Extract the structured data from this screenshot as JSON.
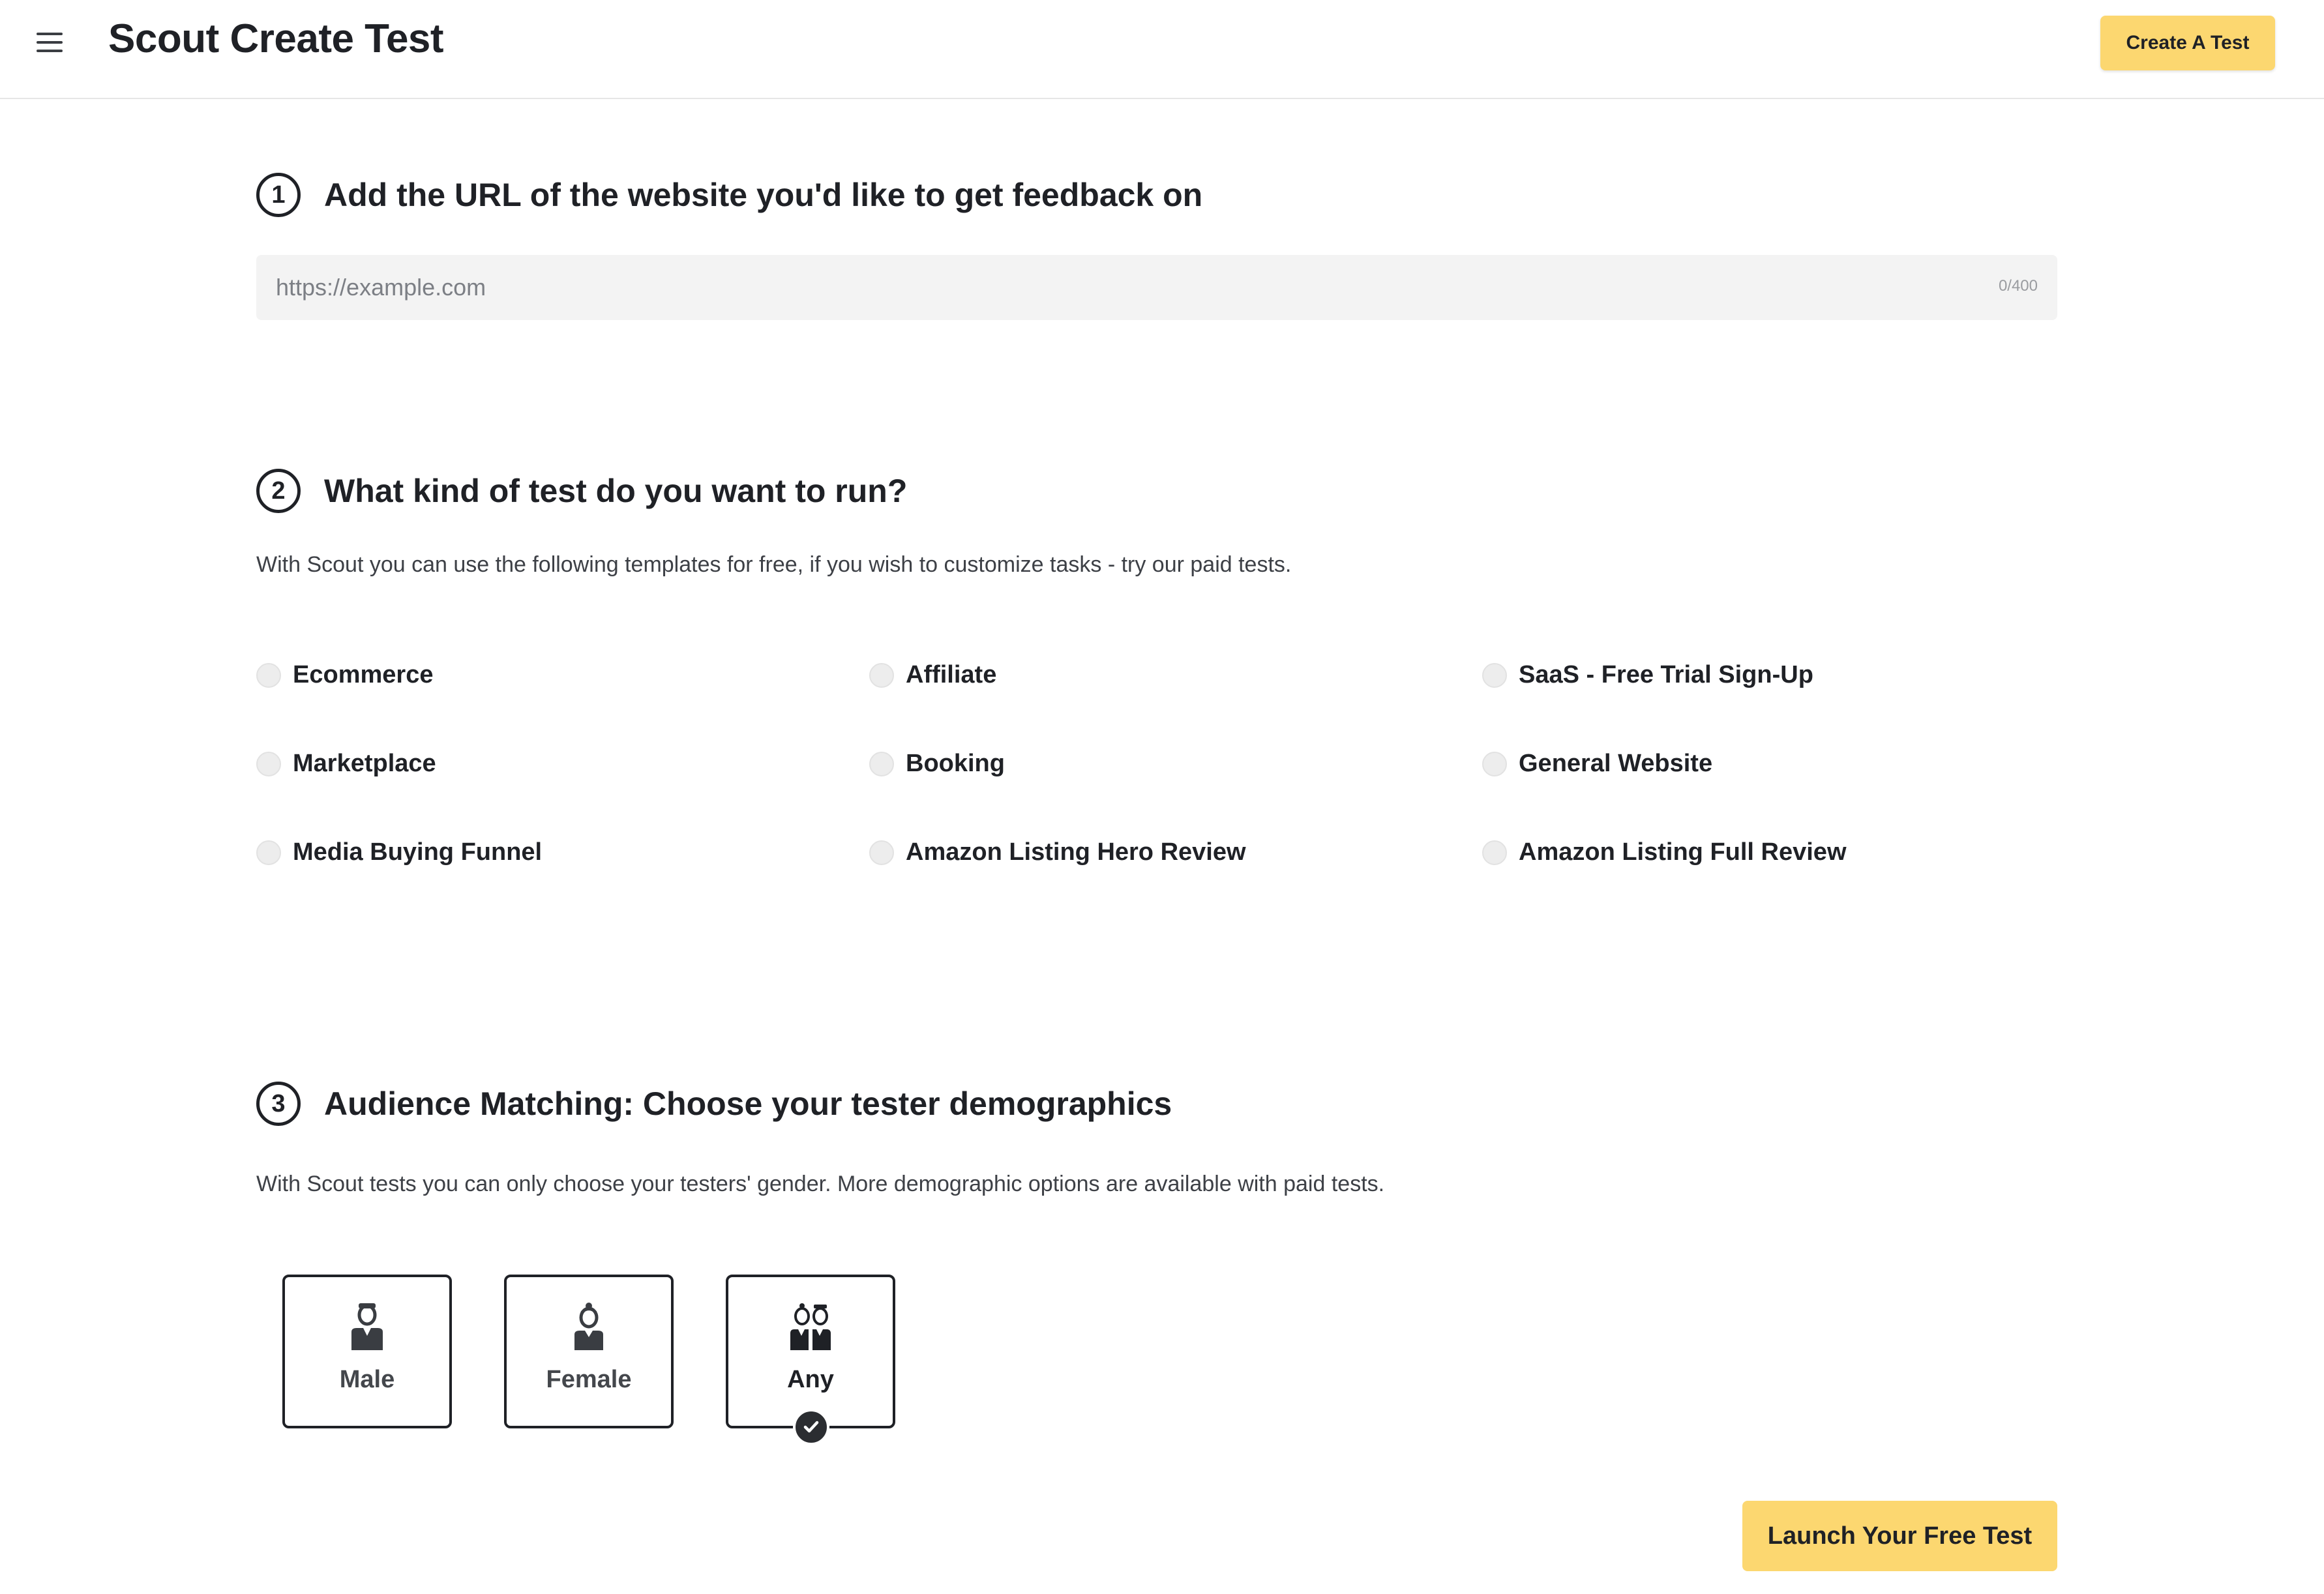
{
  "header": {
    "title": "Scout Create Test",
    "create_button": "Create A Test"
  },
  "step1": {
    "number": "1",
    "title": "Add the URL of the website you'd like to get feedback on",
    "url_placeholder": "https://example.com",
    "url_value": "",
    "counter": "0/400"
  },
  "step2": {
    "number": "2",
    "title": "What kind of test do you want to run?",
    "description": "With Scout you can use the following templates for free, if you wish to customize tasks - try our paid tests.",
    "options": [
      "Ecommerce",
      "Affiliate",
      "SaaS - Free Trial Sign-Up",
      "Marketplace",
      "Booking",
      "General Website",
      "Media Buying Funnel",
      "Amazon Listing Hero Review",
      "Amazon Listing Full Review"
    ]
  },
  "step3": {
    "number": "3",
    "title": "Audience Matching: Choose your tester demographics",
    "description": "With Scout tests you can only choose your testers' gender. More demographic options are available with paid tests.",
    "genders": [
      {
        "label": "Male",
        "icon": "male-person-icon",
        "selected": false
      },
      {
        "label": "Female",
        "icon": "female-person-icon",
        "selected": false
      },
      {
        "label": "Any",
        "icon": "couple-icon",
        "selected": true
      }
    ]
  },
  "launch_button": "Launch Your Free Test",
  "colors": {
    "accent": "#fcd770",
    "text": "#1f2126",
    "field_bg": "#f3f3f3"
  }
}
